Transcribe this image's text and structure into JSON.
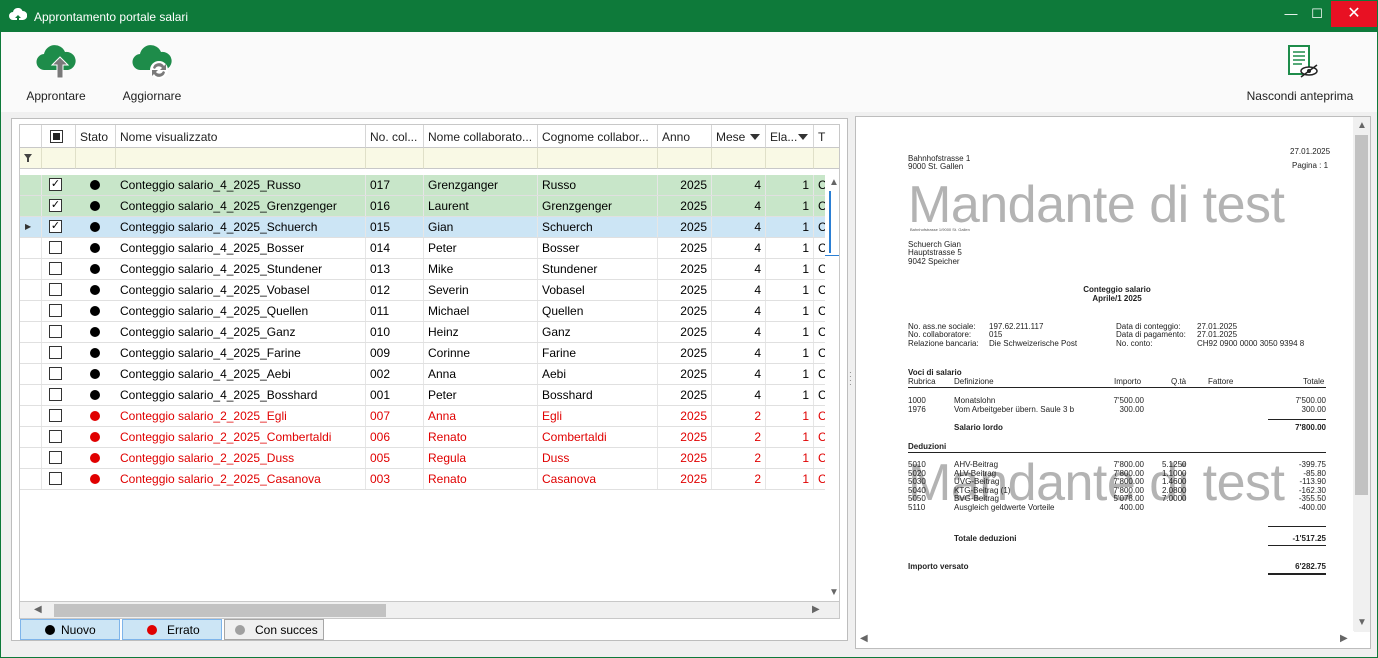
{
  "window": {
    "title": "Approntamento portale salari",
    "minimize": "—",
    "maximize": "☐",
    "close": "✕",
    "title_icon": "cloud-upload-icon"
  },
  "toolbar": {
    "approntare": {
      "label": "Approntare",
      "icon": "cloud-upload-icon"
    },
    "aggiornare": {
      "label": "Aggiornare",
      "icon": "cloud-refresh-icon"
    },
    "nascondi": {
      "label": "Nascondi anteprima",
      "icon": "document-hide-icon"
    }
  },
  "grid": {
    "columns": {
      "stato": "Stato",
      "nome_visualizzato": "Nome visualizzato",
      "no_col": "No. col...",
      "nome_collaboratore": "Nome collaborato...",
      "cognome_collaboratore": "Cognome collabor...",
      "anno": "Anno",
      "mese": "Mese",
      "ela": "Ela...",
      "t": "T"
    },
    "rows": [
      {
        "checked": true,
        "status": "nuovo",
        "name": "Conteggio salario_4_2025_Russo",
        "no": "017",
        "first": "Grenzganger",
        "last": "Russo",
        "anno": "2025",
        "mese": "4",
        "ela": "1",
        "t": "C",
        "style": "green"
      },
      {
        "checked": true,
        "status": "nuovo",
        "name": "Conteggio salario_4_2025_Grenzgenger",
        "no": "016",
        "first": "Laurent",
        "last": "Grenzgenger",
        "anno": "2025",
        "mese": "4",
        "ela": "1",
        "t": "C",
        "style": "green"
      },
      {
        "checked": true,
        "status": "nuovo",
        "name": "Conteggio salario_4_2025_Schuerch",
        "no": "015",
        "first": "Gian",
        "last": "Schuerch",
        "anno": "2025",
        "mese": "4",
        "ela": "1",
        "t": "C",
        "style": "blue",
        "current": true
      },
      {
        "checked": false,
        "status": "nuovo",
        "name": "Conteggio salario_4_2025_Bosser",
        "no": "014",
        "first": "Peter",
        "last": "Bosser",
        "anno": "2025",
        "mese": "4",
        "ela": "1",
        "t": "C",
        "style": ""
      },
      {
        "checked": false,
        "status": "nuovo",
        "name": "Conteggio salario_4_2025_Stundener",
        "no": "013",
        "first": "Mike",
        "last": "Stundener",
        "anno": "2025",
        "mese": "4",
        "ela": "1",
        "t": "C",
        "style": ""
      },
      {
        "checked": false,
        "status": "nuovo",
        "name": "Conteggio salario_4_2025_Vobasel",
        "no": "012",
        "first": "Severin",
        "last": "Vobasel",
        "anno": "2025",
        "mese": "4",
        "ela": "1",
        "t": "C",
        "style": ""
      },
      {
        "checked": false,
        "status": "nuovo",
        "name": "Conteggio salario_4_2025_Quellen",
        "no": "011",
        "first": "Michael",
        "last": "Quellen",
        "anno": "2025",
        "mese": "4",
        "ela": "1",
        "t": "C",
        "style": ""
      },
      {
        "checked": false,
        "status": "nuovo",
        "name": "Conteggio salario_4_2025_Ganz",
        "no": "010",
        "first": "Heinz",
        "last": "Ganz",
        "anno": "2025",
        "mese": "4",
        "ela": "1",
        "t": "C",
        "style": ""
      },
      {
        "checked": false,
        "status": "nuovo",
        "name": "Conteggio salario_4_2025_Farine",
        "no": "009",
        "first": "Corinne",
        "last": "Farine",
        "anno": "2025",
        "mese": "4",
        "ela": "1",
        "t": "C",
        "style": ""
      },
      {
        "checked": false,
        "status": "nuovo",
        "name": "Conteggio salario_4_2025_Aebi",
        "no": "002",
        "first": "Anna",
        "last": "Aebi",
        "anno": "2025",
        "mese": "4",
        "ela": "1",
        "t": "C",
        "style": ""
      },
      {
        "checked": false,
        "status": "nuovo",
        "name": "Conteggio salario_4_2025_Bosshard",
        "no": "001",
        "first": "Peter",
        "last": "Bosshard",
        "anno": "2025",
        "mese": "4",
        "ela": "1",
        "t": "C",
        "style": ""
      },
      {
        "checked": false,
        "status": "errato",
        "name": "Conteggio salario_2_2025_Egli",
        "no": "007",
        "first": "Anna",
        "last": "Egli",
        "anno": "2025",
        "mese": "2",
        "ela": "1",
        "t": "C",
        "style": "red"
      },
      {
        "checked": false,
        "status": "errato",
        "name": "Conteggio salario_2_2025_Combertaldi",
        "no": "006",
        "first": "Renato",
        "last": "Combertaldi",
        "anno": "2025",
        "mese": "2",
        "ela": "1",
        "t": "C",
        "style": "red"
      },
      {
        "checked": false,
        "status": "errato",
        "name": "Conteggio salario_2_2025_Duss",
        "no": "005",
        "first": "Regula",
        "last": "Duss",
        "anno": "2025",
        "mese": "2",
        "ela": "1",
        "t": "C",
        "style": "red"
      },
      {
        "checked": false,
        "status": "errato",
        "name": "Conteggio salario_2_2025_Casanova",
        "no": "003",
        "first": "Renato",
        "last": "Casanova",
        "anno": "2025",
        "mese": "2",
        "ela": "1",
        "t": "C",
        "style": "red"
      }
    ]
  },
  "legend": {
    "nuovo": "Nuovo",
    "errato": "Errato",
    "con_succes": "Con succes"
  },
  "colors": {
    "title_green": "#0e7a3a",
    "status_new": "#000000",
    "status_error": "#e00000",
    "status_success": "#a0a0a0",
    "row_green": "#c8e6c9",
    "row_blue": "#cce5f5",
    "error_text": "#e00000"
  },
  "preview": {
    "watermark": "Mandante di test",
    "date": "27.01.2025",
    "pages": "Pagina :  1",
    "sender_line1": "Bahnhofstrasse 1",
    "sender_line2": "9000 St. Gallen",
    "small_return": "Bahnhofstrasse 1/9000 St. Gallen",
    "recipient_name": "Schuerch Gian",
    "recipient_street": "Hauptstrasse 5",
    "recipient_city": "9042 Speicher",
    "doc_title": "Conteggio salario",
    "doc_period": "Aprile/1 2025",
    "info": {
      "ass_label": "No. ass.ne sociale:",
      "ass_value": "197.62.211.117",
      "coll_label": "No. collaboratore:",
      "coll_value": "015",
      "bank_label": "Relazione bancaria:",
      "bank_value": "Die Schweizerische Post",
      "dc_label": "Data di conteggio:",
      "dc_value": "27.01.2025",
      "dp_label": "Data di pagamento:",
      "dp_value": "27.01.2025",
      "nc_label": "No. conto:",
      "nc_value": "CH92 0900 0000 3050 9394 8"
    },
    "voci": {
      "heading": "Voci di salario",
      "col_rubrica": "Rubrica",
      "col_definizione": "Definizione",
      "col_importo": "Importo",
      "col_qta": "Q.tà",
      "col_fattore": "Fattore",
      "col_totale": "Totale",
      "rows": [
        {
          "r": "1000",
          "d": "Monatslohn",
          "i": "7'500.00",
          "q": "",
          "t": "7'500.00"
        },
        {
          "r": "1976",
          "d": "Vom Arbeitgeber übern. Saule 3 b",
          "i": "300.00",
          "q": "",
          "t": "300.00"
        }
      ],
      "lordo_label": "Salario lordo",
      "lordo_value": "7'800.00"
    },
    "deduzioni": {
      "heading": "Deduzioni",
      "rows": [
        {
          "r": "5010",
          "d": "AHV-Beitrag",
          "i": "7'800.00",
          "q": "5.1250",
          "t": "-399.75"
        },
        {
          "r": "5020",
          "d": "ALV-Beitrag",
          "i": "7'800.00",
          "q": "1.1000",
          "t": "-85.80"
        },
        {
          "r": "5030",
          "d": "UVG-Beitrag",
          "i": "7'800.00",
          "q": "1.4600",
          "t": "-113.90"
        },
        {
          "r": "5040",
          "d": "KTG-Beitrag (1)",
          "i": "7'800.00",
          "q": "2.0800",
          "t": "-162.30"
        },
        {
          "r": "5050",
          "d": "BVG-Beitrag",
          "i": "5'078.00",
          "q": "7.0000",
          "t": "-355.50"
        },
        {
          "r": "5110",
          "d": "Ausgleich geldwerte Vorteile",
          "i": "400.00",
          "q": "",
          "t": "-400.00"
        }
      ],
      "total_label": "Totale deduzioni",
      "total_value": "-1'517.25"
    },
    "versato_label": "Importo versato",
    "versato_value": "6'282.75"
  }
}
